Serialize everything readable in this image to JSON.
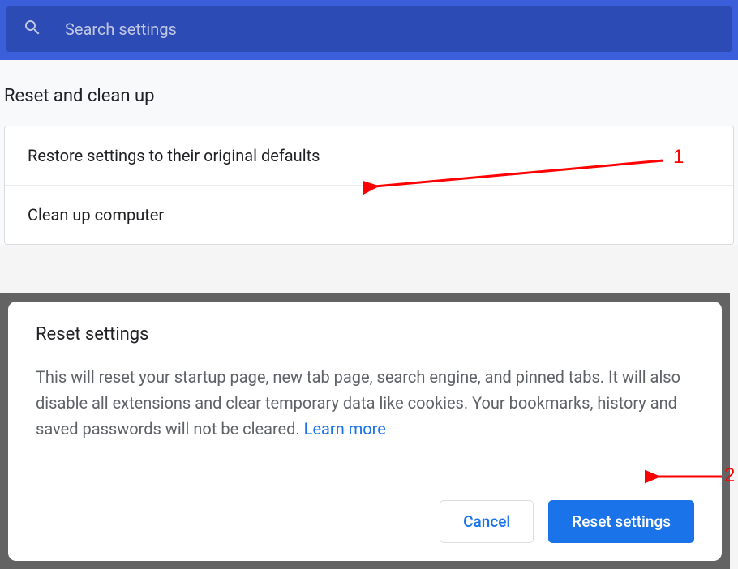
{
  "header": {
    "search_placeholder": "Search settings"
  },
  "section": {
    "title": "Reset and clean up",
    "items": [
      {
        "label": "Restore settings to their original defaults"
      },
      {
        "label": "Clean up computer"
      }
    ]
  },
  "dialog": {
    "title": "Reset settings",
    "body": "This will reset your startup page, new tab page, search engine, and pinned tabs. It will also disable all extensions and clear temporary data like cookies. Your bookmarks, history and saved passwords will not be cleared. ",
    "learn_more": "Learn more",
    "cancel": "Cancel",
    "confirm": "Reset settings"
  },
  "annotations": {
    "one": "1",
    "two": "2"
  }
}
